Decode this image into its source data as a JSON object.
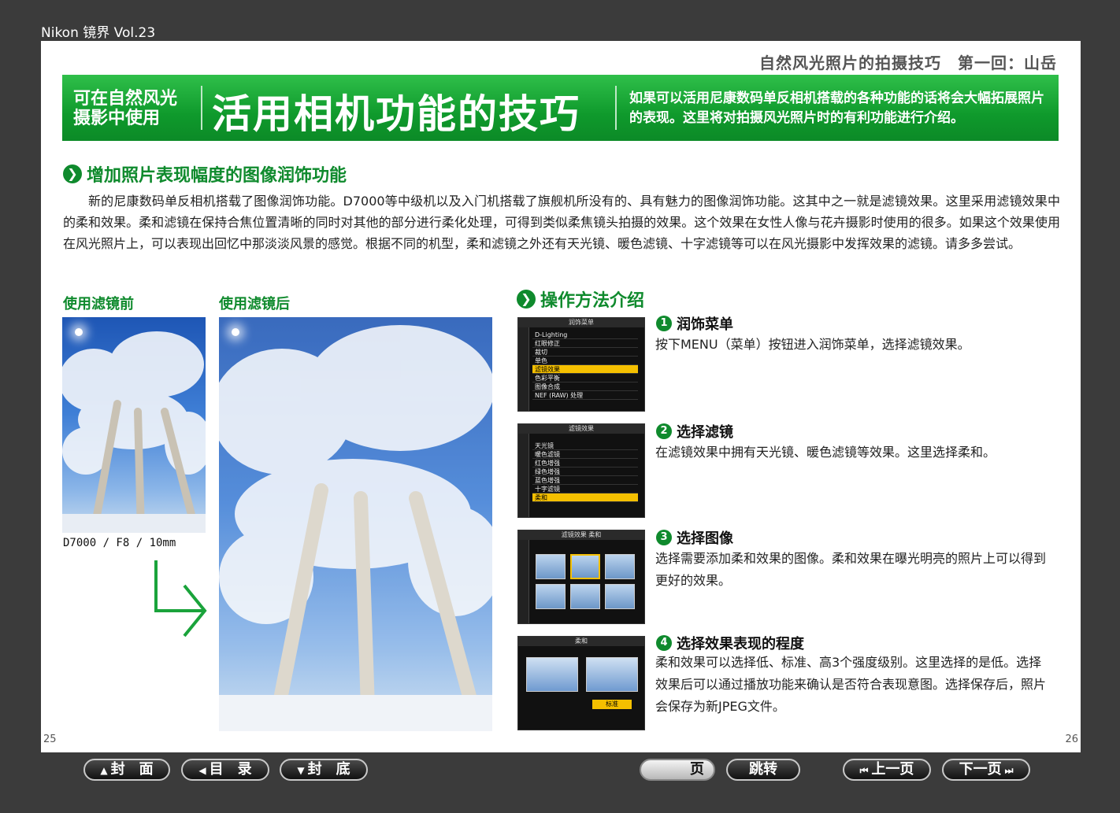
{
  "window": {
    "title": "Nikon 镜界 Vol.23"
  },
  "page": {
    "series": "自然风光照片的拍摄技巧　第一回：山岳",
    "banner": {
      "small": "可在自然风光\n摄影中使用",
      "big": "活用相机功能的技巧",
      "desc": "如果可以活用尼康数码单反相机搭载的各种功能的话将会大幅拓展照片的表现。这里将对拍摄风光照片时的有利功能进行介绍。"
    },
    "section1": {
      "title": "增加照片表现幅度的图像润饰功能",
      "body": "新的尼康数码单反相机搭载了图像润饰功能。D7000等中级机以及入门机搭载了旗舰机所没有的、具有魅力的图像润饰功能。这其中之一就是滤镜效果。这里采用滤镜效果中的柔和效果。柔和滤镜在保持合焦位置清晰的同时对其他的部分进行柔化处理，可得到类似柔焦镜头拍摄的效果。这个效果在女性人像与花卉摄影时使用的很多。如果这个效果使用在风光照片上，可以表现出回忆中那淡淡风景的感觉。根据不同的机型，柔和滤镜之外还有天光镜、暖色滤镜、十字滤镜等可以在风光摄影中发挥效果的滤镜。请多多尝试。"
    },
    "before_label": "使用滤镜前",
    "after_label": "使用滤镜后",
    "caption": "D7000 / F8 / 10mm",
    "section2": {
      "title": "操作方法介绍"
    },
    "screens": {
      "s1": {
        "header": "润饰菜单",
        "items": [
          "D-Lighting",
          "红眼修正",
          "裁切",
          "单色",
          "滤镜效果",
          "色彩平衡",
          "图像合成",
          "NEF (RAW) 处理"
        ]
      },
      "s2": {
        "header": "滤镜效果",
        "items": [
          "天光镜",
          "暖色滤镜",
          "红色增强",
          "绿色增强",
          "蓝色增强",
          "十字滤镜",
          "柔和"
        ]
      },
      "s3": {
        "header": "滤镜效果 柔和"
      },
      "s4": {
        "header": "柔和",
        "mark": "标准"
      }
    },
    "steps": [
      {
        "num": "1",
        "title": "润饰菜单",
        "desc": "按下MENU（菜单）按钮进入润饰菜单，选择滤镜效果。"
      },
      {
        "num": "2",
        "title": "选择滤镜",
        "desc": "在滤镜效果中拥有天光镜、暖色滤镜等效果。这里选择柔和。"
      },
      {
        "num": "3",
        "title": "选择图像",
        "desc": "选择需要添加柔和效果的图像。柔和效果在曝光明亮的照片上可以得到更好的效果。"
      },
      {
        "num": "4",
        "title": "选择效果表现的程度",
        "desc": "柔和效果可以选择低、标准、高3个强度级别。这里选择的是低。选择效果后可以通过播放功能来确认是否符合表现意图。选择保存后，照片会保存为新JPEG文件。"
      }
    ],
    "page_left": "25",
    "page_right": "26"
  },
  "nav": {
    "cover": "封　面",
    "toc": "目　录",
    "back": "封　底",
    "page_label": "页",
    "jump": "跳转",
    "prev": "上一页",
    "next": "下一页",
    "icons": {
      "cover": "triangle-up-icon",
      "toc": "triangle-left-icon",
      "back": "triangle-down-icon",
      "prev": "skip-back-icon",
      "next": "skip-forward-icon"
    }
  }
}
